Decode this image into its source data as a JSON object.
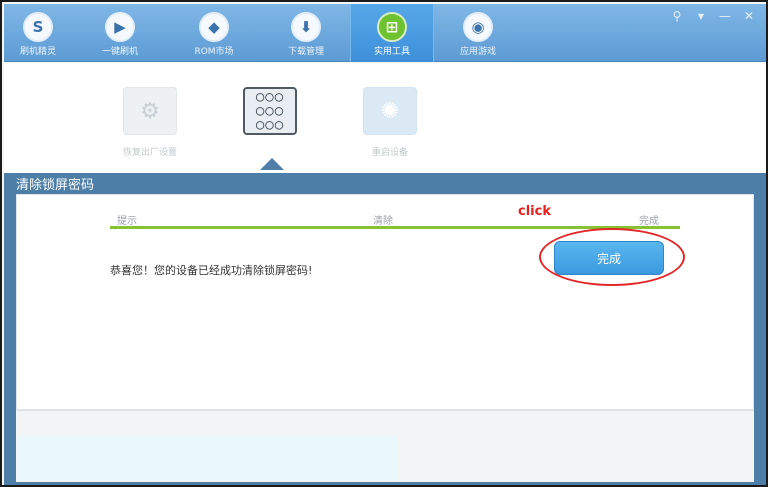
{
  "toolbar": {
    "tabs": [
      {
        "label": "刷机精灵",
        "icon": "S"
      },
      {
        "label": "一键刷机",
        "icon": "▶"
      },
      {
        "label": "ROM市场",
        "icon": "◆"
      },
      {
        "label": "下载管理",
        "icon": "⬇"
      },
      {
        "label": "实用工具",
        "icon": "⊞"
      },
      {
        "label": "应用游戏",
        "icon": "◉"
      }
    ],
    "window_controls": [
      "⚲",
      "▾",
      "—",
      "✕"
    ]
  },
  "tools": [
    {
      "label": "恢复出厂设置",
      "icon": "⚙"
    },
    {
      "label": "",
      "icon": "○○○"
    },
    {
      "label": "重启设备",
      "icon": "✺"
    }
  ],
  "panel": {
    "title": "清除锁屏密码",
    "steps": [
      "提示",
      "清除",
      "完成"
    ],
    "message": "恭喜您！您的设备已经成功清除锁屏密码!",
    "annotation": "click",
    "done_button": "完成"
  },
  "colors": {
    "accent": "#4c7ea8",
    "progress": "#86c232",
    "button": "#3a9ae0",
    "highlight": "#e22828"
  }
}
